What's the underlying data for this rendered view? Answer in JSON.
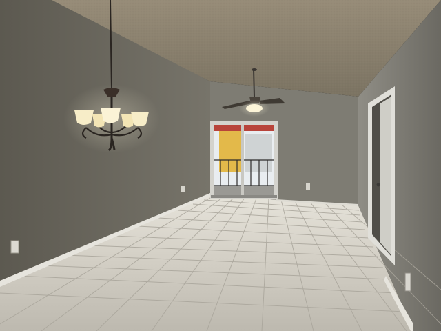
{
  "scene": {
    "subject": "empty-room-interior",
    "elements": [
      "textured-ceiling",
      "left-wall",
      "back-wall",
      "right-wall",
      "tile-floor",
      "baseboards",
      "chandelier",
      "ceiling-fan",
      "sliding-glass-door",
      "interior-door",
      "wall-outlets"
    ]
  },
  "colors": {
    "ceiling": "#9a8f7c",
    "ceiling_dark": "#6f6656",
    "left_wall": "#6a665c",
    "left_wall_dark": "#4f4c44",
    "back_wall": "#7d7b72",
    "right_wall": "#8a887f",
    "right_wall_dark": "#6c6a63",
    "floor": "#c9c5bb",
    "floor_far": "#e2dfd6",
    "grout": "#a8a49a",
    "baseboard": "#e8e6df",
    "lamp_glow": "#f7edc8",
    "metal": "#2a2521",
    "door_frame": "#d8d7d1",
    "door": "#bfbdb6",
    "balcony_awning": "#b8443a",
    "balcony_yellow": "#e3b94a",
    "balcony_sky": "#e9edf0"
  }
}
